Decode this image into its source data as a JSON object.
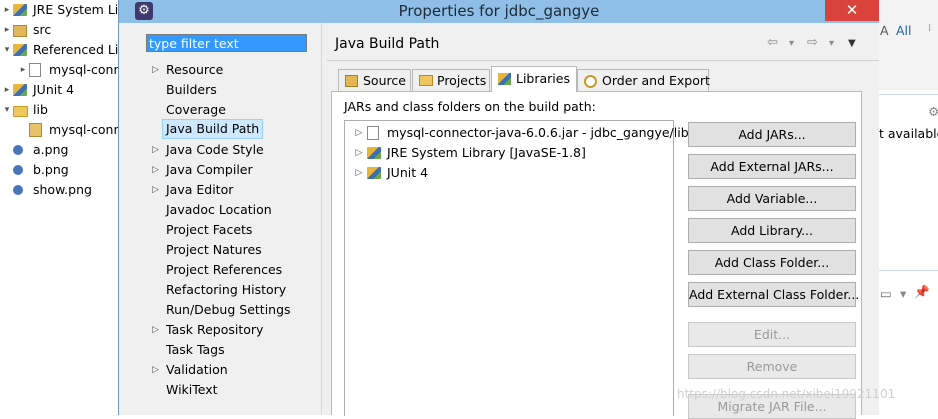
{
  "background_tree": {
    "items": [
      {
        "label": "JRE System Lib",
        "icon": "library-icon",
        "twistie": "▸"
      },
      {
        "label": "src",
        "icon": "package-folder-icon",
        "twistie": "▸"
      },
      {
        "label": "Referenced Lib",
        "icon": "library-icon",
        "twistie": "▾"
      },
      {
        "label": "mysql-conn",
        "icon": "jar-icon",
        "twistie": "▸"
      },
      {
        "label": "JUnit 4",
        "icon": "library-icon",
        "twistie": "▸"
      },
      {
        "label": "lib",
        "icon": "folder-icon",
        "twistie": "▾"
      },
      {
        "label": "mysql-conn",
        "icon": "jar-file-icon",
        "twistie": ""
      },
      {
        "label": "a.png",
        "icon": "image-file-icon",
        "twistie": ""
      },
      {
        "label": "b.png",
        "icon": "image-file-icon",
        "twistie": ""
      },
      {
        "label": "show.png",
        "icon": "image-file-icon",
        "twistie": ""
      }
    ]
  },
  "background_right": {
    "all_link": "All",
    "a_text": "A",
    "available_text": "t available",
    "n_text": "N"
  },
  "dialog": {
    "title": "Properties for jdbc_gangye",
    "close_glyph": "✕",
    "filter_placeholder": "type filter text",
    "nav_items": [
      {
        "label": "Resource",
        "expandable": true,
        "selected": false
      },
      {
        "label": "Builders",
        "expandable": false,
        "selected": false
      },
      {
        "label": "Coverage",
        "expandable": false,
        "selected": false
      },
      {
        "label": "Java Build Path",
        "expandable": false,
        "selected": true
      },
      {
        "label": "Java Code Style",
        "expandable": true,
        "selected": false
      },
      {
        "label": "Java Compiler",
        "expandable": true,
        "selected": false
      },
      {
        "label": "Java Editor",
        "expandable": true,
        "selected": false
      },
      {
        "label": "Javadoc Location",
        "expandable": false,
        "selected": false
      },
      {
        "label": "Project Facets",
        "expandable": false,
        "selected": false
      },
      {
        "label": "Project Natures",
        "expandable": false,
        "selected": false
      },
      {
        "label": "Project References",
        "expandable": false,
        "selected": false
      },
      {
        "label": "Refactoring History",
        "expandable": false,
        "selected": false
      },
      {
        "label": "Run/Debug Settings",
        "expandable": false,
        "selected": false
      },
      {
        "label": "Task Repository",
        "expandable": true,
        "selected": false
      },
      {
        "label": "Task Tags",
        "expandable": false,
        "selected": false
      },
      {
        "label": "Validation",
        "expandable": true,
        "selected": false
      },
      {
        "label": "WikiText",
        "expandable": false,
        "selected": false
      }
    ],
    "page_title": "Java Build Path",
    "history": {
      "back": "⇦",
      "back_menu": "▾",
      "forward": "⇨",
      "forward_menu": "▾",
      "view_menu": "▼"
    },
    "tabs": [
      {
        "label": "Source",
        "icon": "source-folder-icon",
        "active": false
      },
      {
        "label": "Projects",
        "icon": "projects-icon",
        "active": false
      },
      {
        "label": "Libraries",
        "icon": "libraries-icon",
        "active": true
      },
      {
        "label": "Order and Export",
        "icon": "order-export-icon",
        "active": false
      }
    ],
    "content_label": "JARs and class folders on the build path:",
    "classpath_entries": [
      {
        "label": "mysql-connector-java-6.0.6.jar - jdbc_gangye/lib",
        "icon": "jar-icon",
        "twistie": "▷"
      },
      {
        "label": "JRE System Library [JavaSE-1.8]",
        "icon": "library-icon",
        "twistie": "▷"
      },
      {
        "label": "JUnit 4",
        "icon": "library-icon",
        "twistie": "▷"
      }
    ],
    "buttons": [
      {
        "label": "Add JARs...",
        "enabled": true
      },
      {
        "label": "Add External JARs...",
        "enabled": true
      },
      {
        "label": "Add Variable...",
        "enabled": true
      },
      {
        "label": "Add Library...",
        "enabled": true
      },
      {
        "label": "Add Class Folder...",
        "enabled": true
      },
      {
        "label": "Add External Class Folder...",
        "enabled": true
      },
      {
        "label": "Edit...",
        "enabled": false
      },
      {
        "label": "Remove",
        "enabled": false
      },
      {
        "label": "Migrate JAR File...",
        "enabled": false
      }
    ]
  },
  "watermark": "https://blog.csdn.net/xibei19921101",
  "colors": {
    "titlebar": "#8fbfe6",
    "close": "#d9433b",
    "selection": "#cde8ff",
    "filter_selection": "#3399ff"
  }
}
